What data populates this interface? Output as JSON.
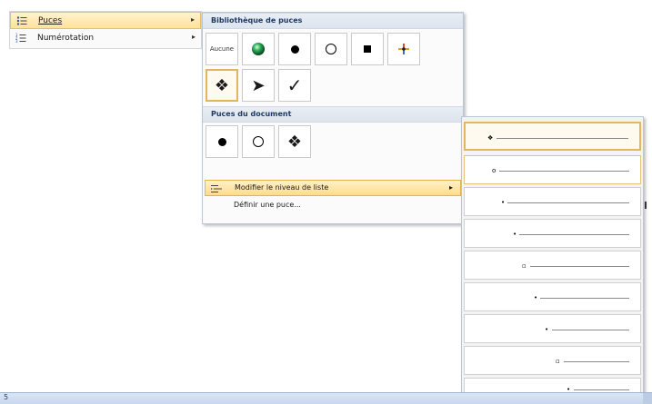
{
  "context_menu": {
    "items": [
      {
        "label": "Puces",
        "icon": "bullets-icon",
        "has_submenu": true
      },
      {
        "label": "Numérotation",
        "icon": "numbering-icon",
        "has_submenu": true
      }
    ]
  },
  "bullet_library": {
    "header": "Bibliothèque de puces",
    "none_label": "Aucune",
    "items": [
      "green-sphere",
      "filled-dot",
      "hollow-circle",
      "filled-square",
      "colored-star",
      "four-diamonds",
      "arrowhead",
      "checkmark"
    ],
    "glyphs": {
      "diamonds": "❖",
      "arrowhead": "➤",
      "check": "✓"
    }
  },
  "document_bullets": {
    "header": "Puces du document",
    "items": [
      "filled-dot",
      "hollow-circle",
      "four-diamonds"
    ]
  },
  "commands": {
    "change_level": "Modifier le niveau de liste",
    "define_bullet": "Définir une puce..."
  },
  "list_levels": {
    "markers": [
      "❖",
      "o",
      "•",
      "•",
      "▫",
      "•",
      "•",
      "▫",
      "•"
    ]
  },
  "status_bar": {
    "text": "5"
  },
  "colors": {
    "accent": "#e4b65a",
    "header_text": "#1f3a60",
    "panel_border": "#b9c6d6"
  }
}
